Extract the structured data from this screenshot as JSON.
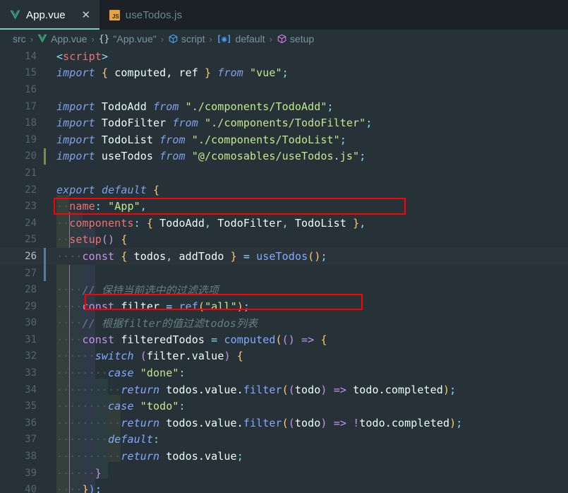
{
  "window": {
    "app": "vscode-editor",
    "background": "#263238"
  },
  "tabs": [
    {
      "label": "App.vue",
      "icon": "vue-icon",
      "active": true,
      "close_glyph": "✕"
    },
    {
      "label": "useTodos.js",
      "icon": "js-icon",
      "icon_text": "JS",
      "active": false
    }
  ],
  "breadcrumb": {
    "separator": "›",
    "items": [
      {
        "label": "src",
        "icon": "none"
      },
      {
        "label": "App.vue",
        "icon": "vue-icon"
      },
      {
        "label": "\"App.vue\"",
        "icon": "braces-icon"
      },
      {
        "label": "script",
        "icon": "cube-blue-icon"
      },
      {
        "label": "default",
        "icon": "brackets-at-icon"
      },
      {
        "label": "setup",
        "icon": "cube-purple-icon"
      }
    ]
  },
  "colors": {
    "editor_bg": "#263238",
    "tabbar_bg": "#1b2127",
    "active_tab_underline": "#80cbc4",
    "annotation_red": "#ff0000",
    "gutter_modified_green": "#7b8a4e",
    "gutter_modified_blue": "#5c7a9e",
    "current_line_bg": "#2b343b"
  },
  "editor": {
    "first_line_number": 14,
    "current_line": 26,
    "gutter_marks": [
      {
        "line": 20,
        "color": "green"
      },
      {
        "line": 26,
        "color": "blue"
      },
      {
        "line": 27,
        "color": "blue"
      }
    ],
    "annotations": [
      {
        "target_line": 20,
        "note": "red-box-import-useTodos"
      },
      {
        "target_line": 26,
        "note": "red-box-const-useTodos"
      }
    ],
    "lines": [
      {
        "n": 14,
        "tokens": [
          {
            "t": "&lt;",
            "c": "t-punc"
          },
          {
            "t": "script",
            "c": "t-tag"
          },
          {
            "t": "&gt;",
            "c": "t-punc"
          }
        ]
      },
      {
        "n": 15,
        "tokens": [
          {
            "t": "import",
            "c": "t-kw"
          },
          {
            "t": " ",
            "c": "t-plain"
          },
          {
            "t": "{",
            "c": "t-brace"
          },
          {
            "t": " computed, ref ",
            "c": "t-var"
          },
          {
            "t": "}",
            "c": "t-brace"
          },
          {
            "t": " ",
            "c": "t-plain"
          },
          {
            "t": "from",
            "c": "t-kw"
          },
          {
            "t": " ",
            "c": "t-plain"
          },
          {
            "t": "\"vue\"",
            "c": "t-str"
          },
          {
            "t": ";",
            "c": "t-punc"
          }
        ]
      },
      {
        "n": 16,
        "tokens": []
      },
      {
        "n": 17,
        "tokens": [
          {
            "t": "import",
            "c": "t-kw"
          },
          {
            "t": " TodoAdd ",
            "c": "t-var"
          },
          {
            "t": "from",
            "c": "t-kw"
          },
          {
            "t": " ",
            "c": "t-plain"
          },
          {
            "t": "\"./components/TodoAdd\"",
            "c": "t-str"
          },
          {
            "t": ";",
            "c": "t-punc"
          }
        ]
      },
      {
        "n": 18,
        "tokens": [
          {
            "t": "import",
            "c": "t-kw"
          },
          {
            "t": " TodoFilter ",
            "c": "t-var"
          },
          {
            "t": "from",
            "c": "t-kw"
          },
          {
            "t": " ",
            "c": "t-plain"
          },
          {
            "t": "\"./components/TodoFilter\"",
            "c": "t-str"
          },
          {
            "t": ";",
            "c": "t-punc"
          }
        ]
      },
      {
        "n": 19,
        "tokens": [
          {
            "t": "import",
            "c": "t-kw"
          },
          {
            "t": " TodoList ",
            "c": "t-var"
          },
          {
            "t": "from",
            "c": "t-kw"
          },
          {
            "t": " ",
            "c": "t-plain"
          },
          {
            "t": "\"./components/TodoList\"",
            "c": "t-str"
          },
          {
            "t": ";",
            "c": "t-punc"
          }
        ]
      },
      {
        "n": 20,
        "tokens": [
          {
            "t": "import",
            "c": "t-kw"
          },
          {
            "t": " useTodos ",
            "c": "t-var"
          },
          {
            "t": "from",
            "c": "t-kw"
          },
          {
            "t": " ",
            "c": "t-plain"
          },
          {
            "t": "\"@/comosables/useTodos.js\"",
            "c": "t-str"
          },
          {
            "t": ";",
            "c": "t-punc"
          }
        ]
      },
      {
        "n": 21,
        "tokens": []
      },
      {
        "n": 22,
        "tokens": [
          {
            "t": "export",
            "c": "t-kw"
          },
          {
            "t": " ",
            "c": "t-plain"
          },
          {
            "t": "default",
            "c": "t-kw"
          },
          {
            "t": " ",
            "c": "t-plain"
          },
          {
            "t": "{",
            "c": "t-brace"
          }
        ]
      },
      {
        "n": 23,
        "tokens": [
          {
            "t": "··",
            "c": "ws"
          },
          {
            "t": "name",
            "c": "t-prop"
          },
          {
            "t": ": ",
            "c": "t-punc"
          },
          {
            "t": "\"App\"",
            "c": "t-str"
          },
          {
            "t": ",",
            "c": "t-punc"
          }
        ]
      },
      {
        "n": 24,
        "tokens": [
          {
            "t": "··",
            "c": "ws"
          },
          {
            "t": "components",
            "c": "t-prop"
          },
          {
            "t": ": ",
            "c": "t-punc"
          },
          {
            "t": "{",
            "c": "t-brace"
          },
          {
            "t": " TodoAdd",
            "c": "t-var"
          },
          {
            "t": ",",
            "c": "t-punc"
          },
          {
            "t": " TodoFilter",
            "c": "t-var"
          },
          {
            "t": ",",
            "c": "t-punc"
          },
          {
            "t": " TodoList ",
            "c": "t-var"
          },
          {
            "t": "}",
            "c": "t-brace"
          },
          {
            "t": ",",
            "c": "t-punc"
          }
        ]
      },
      {
        "n": 25,
        "tokens": [
          {
            "t": "··",
            "c": "ws"
          },
          {
            "t": "setup",
            "c": "t-prop"
          },
          {
            "t": "()",
            "c": "t-paren2"
          },
          {
            "t": " ",
            "c": "t-plain"
          },
          {
            "t": "{",
            "c": "t-brace"
          }
        ]
      },
      {
        "n": 26,
        "tokens": [
          {
            "t": "····",
            "c": "ws"
          },
          {
            "t": "const",
            "c": "t-kw2"
          },
          {
            "t": " ",
            "c": "t-plain"
          },
          {
            "t": "{",
            "c": "t-brace"
          },
          {
            "t": " todos",
            "c": "t-var"
          },
          {
            "t": ",",
            "c": "t-punc"
          },
          {
            "t": " addTodo ",
            "c": "t-var"
          },
          {
            "t": "}",
            "c": "t-brace"
          },
          {
            "t": " ",
            "c": "t-plain"
          },
          {
            "t": "=",
            "c": "t-op"
          },
          {
            "t": " ",
            "c": "t-plain"
          },
          {
            "t": "useTodos",
            "c": "t-fn"
          },
          {
            "t": "()",
            "c": "t-paren"
          },
          {
            "t": ";",
            "c": "t-punc"
          }
        ]
      },
      {
        "n": 27,
        "tokens": []
      },
      {
        "n": 28,
        "tokens": [
          {
            "t": "····",
            "c": "ws"
          },
          {
            "t": "// 保持当前选中的过滤选项",
            "c": "t-comment"
          }
        ]
      },
      {
        "n": 29,
        "tokens": [
          {
            "t": "····",
            "c": "ws"
          },
          {
            "t": "const",
            "c": "t-kw2"
          },
          {
            "t": " filter ",
            "c": "t-var"
          },
          {
            "t": "=",
            "c": "t-op"
          },
          {
            "t": " ",
            "c": "t-plain"
          },
          {
            "t": "ref",
            "c": "t-fn"
          },
          {
            "t": "(",
            "c": "t-paren"
          },
          {
            "t": "\"all\"",
            "c": "t-str"
          },
          {
            "t": ")",
            "c": "t-paren"
          },
          {
            "t": ";",
            "c": "t-punc"
          }
        ]
      },
      {
        "n": 30,
        "tokens": [
          {
            "t": "····",
            "c": "ws"
          },
          {
            "t": "// 根据filter的值过滤todos列表",
            "c": "t-comment"
          }
        ]
      },
      {
        "n": 31,
        "tokens": [
          {
            "t": "····",
            "c": "ws"
          },
          {
            "t": "const",
            "c": "t-kw2"
          },
          {
            "t": " filteredTodos ",
            "c": "t-var"
          },
          {
            "t": "=",
            "c": "t-op"
          },
          {
            "t": " ",
            "c": "t-plain"
          },
          {
            "t": "computed",
            "c": "t-fn"
          },
          {
            "t": "(",
            "c": "t-paren"
          },
          {
            "t": "()",
            "c": "t-paren2"
          },
          {
            "t": " ",
            "c": "t-plain"
          },
          {
            "t": "=&gt;",
            "c": "t-arrow"
          },
          {
            "t": " ",
            "c": "t-plain"
          },
          {
            "t": "{",
            "c": "t-brace"
          }
        ]
      },
      {
        "n": 32,
        "tokens": [
          {
            "t": "······",
            "c": "ws"
          },
          {
            "t": "switch",
            "c": "t-kwi"
          },
          {
            "t": " ",
            "c": "t-plain"
          },
          {
            "t": "(",
            "c": "t-paren2"
          },
          {
            "t": "filter.value",
            "c": "t-var"
          },
          {
            "t": ")",
            "c": "t-paren2"
          },
          {
            "t": " ",
            "c": "t-plain"
          },
          {
            "t": "{",
            "c": "t-brace"
          }
        ]
      },
      {
        "n": 33,
        "tokens": [
          {
            "t": "········",
            "c": "ws"
          },
          {
            "t": "case",
            "c": "t-kwi"
          },
          {
            "t": " ",
            "c": "t-plain"
          },
          {
            "t": "\"done\"",
            "c": "t-str"
          },
          {
            "t": ":",
            "c": "t-punc"
          }
        ]
      },
      {
        "n": 34,
        "tokens": [
          {
            "t": "··········",
            "c": "ws"
          },
          {
            "t": "return",
            "c": "t-kwi"
          },
          {
            "t": " todos.value.",
            "c": "t-var"
          },
          {
            "t": "filter",
            "c": "t-fn"
          },
          {
            "t": "(",
            "c": "t-paren"
          },
          {
            "t": "(",
            "c": "t-paren2"
          },
          {
            "t": "todo",
            "c": "t-var"
          },
          {
            "t": ")",
            "c": "t-paren2"
          },
          {
            "t": " ",
            "c": "t-plain"
          },
          {
            "t": "=&gt;",
            "c": "t-arrow"
          },
          {
            "t": " todo.completed",
            "c": "t-var"
          },
          {
            "t": ")",
            "c": "t-paren"
          },
          {
            "t": ";",
            "c": "t-punc"
          }
        ]
      },
      {
        "n": 35,
        "tokens": [
          {
            "t": "········",
            "c": "ws"
          },
          {
            "t": "case",
            "c": "t-kwi"
          },
          {
            "t": " ",
            "c": "t-plain"
          },
          {
            "t": "\"todo\"",
            "c": "t-str"
          },
          {
            "t": ":",
            "c": "t-punc"
          }
        ]
      },
      {
        "n": 36,
        "tokens": [
          {
            "t": "··········",
            "c": "ws"
          },
          {
            "t": "return",
            "c": "t-kwi"
          },
          {
            "t": " todos.value.",
            "c": "t-var"
          },
          {
            "t": "filter",
            "c": "t-fn"
          },
          {
            "t": "(",
            "c": "t-paren"
          },
          {
            "t": "(",
            "c": "t-paren2"
          },
          {
            "t": "todo",
            "c": "t-var"
          },
          {
            "t": ")",
            "c": "t-paren2"
          },
          {
            "t": " ",
            "c": "t-plain"
          },
          {
            "t": "=&gt;",
            "c": "t-arrow"
          },
          {
            "t": " ",
            "c": "t-plain"
          },
          {
            "t": "!",
            "c": "t-kw2"
          },
          {
            "t": "todo.completed",
            "c": "t-var"
          },
          {
            "t": ")",
            "c": "t-paren"
          },
          {
            "t": ";",
            "c": "t-punc"
          }
        ]
      },
      {
        "n": 37,
        "tokens": [
          {
            "t": "········",
            "c": "ws"
          },
          {
            "t": "default",
            "c": "t-kwi"
          },
          {
            "t": ":",
            "c": "t-punc"
          }
        ]
      },
      {
        "n": 38,
        "tokens": [
          {
            "t": "··········",
            "c": "ws"
          },
          {
            "t": "return",
            "c": "t-kwi"
          },
          {
            "t": " todos.value",
            "c": "t-var"
          },
          {
            "t": ";",
            "c": "t-punc"
          }
        ]
      },
      {
        "n": 39,
        "tokens": [
          {
            "t": "······",
            "c": "ws"
          },
          {
            "t": "}",
            "c": "t-paren2"
          }
        ]
      },
      {
        "n": 40,
        "tokens": [
          {
            "t": "····",
            "c": "ws"
          },
          {
            "t": "}",
            "c": "t-brace"
          },
          {
            "t": ")",
            "c": "t-fn"
          },
          {
            "t": ";",
            "c": "t-cyan"
          }
        ]
      }
    ]
  }
}
